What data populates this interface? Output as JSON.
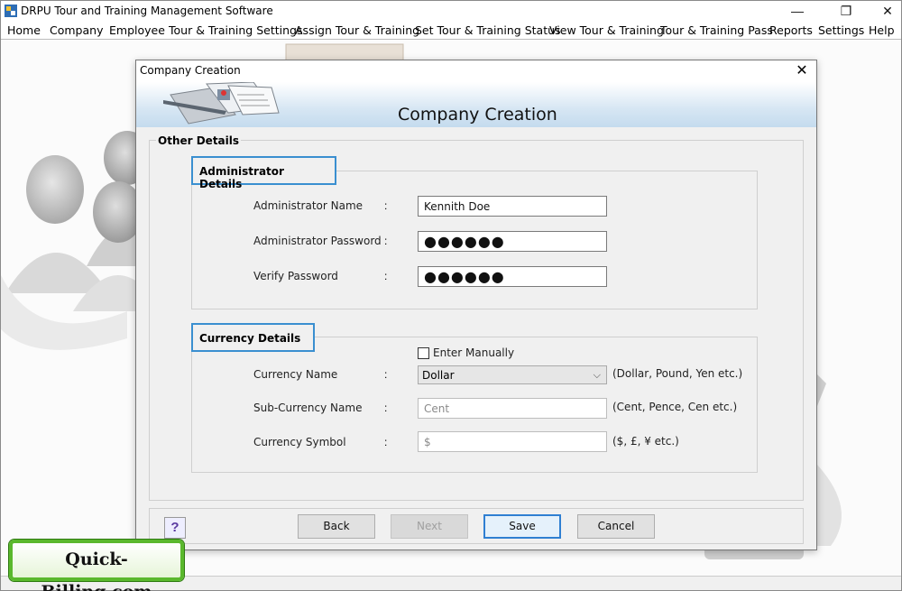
{
  "app": {
    "title": "DRPU Tour and Training Management Software",
    "controls": {
      "minimize": "—",
      "maximize": "❐",
      "close": "✕"
    }
  },
  "menu": [
    "Home",
    "Company",
    "Employee",
    "Tour & Training Settings",
    "Assign Tour & Training",
    "Set Tour & Training Status",
    "View Tour & Training",
    "Tour & Training Pass",
    "Reports",
    "Settings",
    "Help"
  ],
  "dialog": {
    "window_title": "Company Creation",
    "header_title": "Company Creation",
    "close": "✕",
    "group_caption": "Other Details",
    "admin": {
      "section_title": "Administrator Details",
      "name_label": "Administrator Name",
      "name_value": "Kennith Doe",
      "password_label": "Administrator Password",
      "password_value": "●●●●●●",
      "verify_label": "Verify Password",
      "verify_value": "●●●●●●"
    },
    "currency": {
      "section_title": "Currency Details",
      "enter_manually_label": "Enter Manually",
      "enter_manually_checked": false,
      "name_label": "Currency Name",
      "name_value": "Dollar",
      "name_hint": "(Dollar, Pound, Yen etc.)",
      "sub_label": "Sub-Currency Name",
      "sub_value": "Cent",
      "sub_hint": "(Cent, Pence, Cen etc.)",
      "symbol_label": "Currency Symbol",
      "symbol_value": "$",
      "symbol_hint": "($, £, ¥ etc.)"
    },
    "colon": ":",
    "buttons": {
      "help": "?",
      "back": "Back",
      "next": "Next",
      "save": "Save",
      "cancel": "Cancel"
    }
  },
  "badge": "Quick-Billing.com",
  "colors": {
    "accent": "#3a8fd0",
    "badge_border": "#5ab82d",
    "header_gradient": "#c4dbee"
  }
}
